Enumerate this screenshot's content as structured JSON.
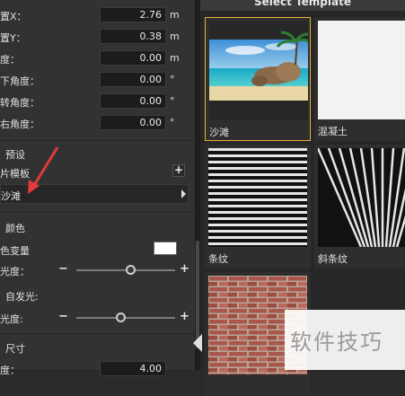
{
  "properties": {
    "rows": [
      {
        "label": "置X：",
        "value": "2.76",
        "unit": "m"
      },
      {
        "label": "置Y：",
        "value": "0.38",
        "unit": "m"
      },
      {
        "label": "度：",
        "value": "0.00",
        "unit": "m"
      },
      {
        "label": "下角度：",
        "value": "0.00",
        "unit": "°"
      },
      {
        "label": "转角度：",
        "value": "0.00",
        "unit": "°"
      },
      {
        "label": "右角度：",
        "value": "0.00",
        "unit": "°"
      }
    ]
  },
  "preset": {
    "title": "预设",
    "template_label": "片模板",
    "add_symbol": "+",
    "selected_value": "沙滩"
  },
  "color_section": {
    "title": "颜色",
    "variant_label": "色变量",
    "swatch_color": "#ffffff",
    "brightness_label": "光度：",
    "brightness_level": 0.55,
    "emissive_label": "自发光:",
    "emissive_brightness_label": "光度:",
    "emissive_level": 0.45,
    "minus_symbol": "−",
    "plus_symbol": "+"
  },
  "size_section": {
    "title": "尺寸",
    "row_label": "度：",
    "row_value": "4.00"
  },
  "template_panel": {
    "title": "Select Template",
    "items": [
      {
        "label": "沙滩",
        "selected": true
      },
      {
        "label": "混凝土",
        "selected": false
      },
      {
        "label": "条纹",
        "selected": false
      },
      {
        "label": "斜条纹",
        "selected": false
      },
      {
        "label": "",
        "selected": false
      }
    ]
  },
  "watermark": {
    "text": "软件技巧"
  },
  "accent_color": "#e6b33a",
  "annotation_color": "#e23a3a"
}
